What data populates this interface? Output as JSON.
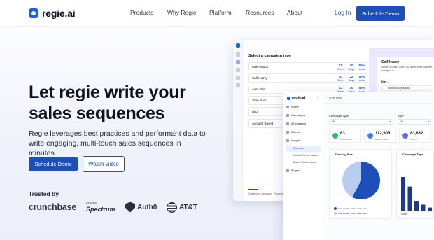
{
  "nav": {
    "logo_text": "regie.ai",
    "items": [
      "Products",
      "Why Regie",
      "Platform",
      "Resources",
      "About"
    ],
    "login": "Log In",
    "cta": "Schedule Demo"
  },
  "hero": {
    "title": "Let regie write your sales sequences",
    "subtitle": "Regie leverages best practices and performant data to write engaging, multi-touch sales sequences in minutes.",
    "primary_button": "Schedule Demo",
    "secondary_button": "Watch video",
    "trusted_label": "Trusted by",
    "brands": {
      "crunchbase": "crunchbase",
      "spectrum_prefix": "Charter",
      "spectrum": "Spectrum",
      "auth0": "Auth0",
      "att": "AT&T"
    }
  },
  "back_panel": {
    "heading": "Select a campaign type",
    "campaigns": [
      {
        "name": "Multi-Touch",
        "stats": [
          {
            "v": "15",
            "l": "Steps"
          },
          {
            "v": "30",
            "l": "Days"
          },
          {
            "v": "80%",
            "l": "Auto"
          }
        ]
      },
      {
        "name": "Call Heavy",
        "stats": [
          {
            "v": "11",
            "l": "Steps"
          },
          {
            "v": "22",
            "l": "Days"
          },
          {
            "v": "50%",
            "l": "Auto"
          }
        ]
      },
      {
        "name": "Auto-Pilot",
        "stats": [
          {
            "v": "13",
            "l": "Steps"
          },
          {
            "v": "30",
            "l": "Days"
          },
          {
            "v": "98%",
            "l": "Auto"
          }
        ]
      },
      {
        "name": "Slow Burn",
        "stats": []
      },
      {
        "name": "Blitz",
        "stats": []
      },
      {
        "name": "Account Based",
        "stats": []
      }
    ],
    "call_card": {
      "title": "Call Heavy",
      "description": "Similar to Multi-Touch, but a few extra calls are swapped in.",
      "day": "Day 1",
      "items": [
        "Intro Email (manual)",
        "",
        ""
      ]
    },
    "tabs": [
      "Guidelines",
      "Campaign",
      "Persona"
    ]
  },
  "front_panel": {
    "logo": "regie.ai",
    "collapse": "«",
    "nav": [
      {
        "label": "Home"
      },
      {
        "label": "Campaigns"
      },
      {
        "label": "AI Assistant"
      },
      {
        "label": "Blocks"
      },
      {
        "label": "Insights"
      }
    ],
    "sub_nav": [
      "Overview",
      "Content Performance",
      "Blocks Performance"
    ],
    "nav_bottom": "Plugins",
    "title": "Overview",
    "filters": [
      {
        "label": "Campaign Type",
        "value": "All"
      },
      {
        "label": "Type",
        "value": "All"
      }
    ],
    "stats": [
      {
        "value": "63",
        "label": "CADENCES",
        "color": "#22c55e"
      },
      {
        "value": "112,905",
        "label": "EMAILS SENT",
        "color": "#3b82f6"
      },
      {
        "value": "83,832",
        "label": "VIEWS",
        "color": "#6366f1"
      }
    ],
    "delivery_card": {
      "title": "Delivery Size",
      "legend": [
        "Seq. emails < 100 Emails Sent",
        "Seq. emails > 100 Emails Sent"
      ],
      "colors": [
        "#1e4fb8",
        "#b9cdf0"
      ]
    },
    "campaign_card": {
      "title": "Campaign Type",
      "bar_color": "#1e3a8a",
      "bar_values": [
        0.72,
        0.52,
        0.22,
        0.14,
        0.08
      ]
    }
  },
  "chart_data": [
    {
      "type": "pie",
      "title": "Delivery Size",
      "categories": [
        "Seq. emails < 100 Emails Sent",
        "Seq. emails > 100 Emails Sent"
      ],
      "values": [
        58,
        42
      ]
    },
    {
      "type": "bar",
      "title": "Campaign Type",
      "categories": [
        "COLD",
        "",
        "",
        "",
        ""
      ],
      "values": [
        0.72,
        0.52,
        0.22,
        0.14,
        0.08
      ]
    }
  ]
}
